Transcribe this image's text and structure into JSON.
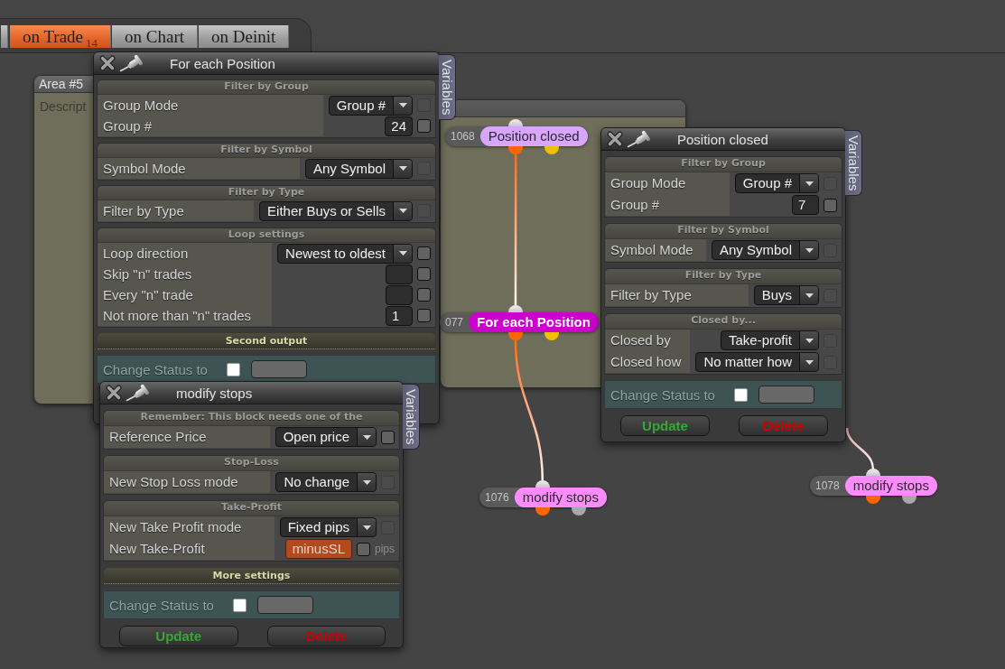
{
  "tabs": [
    {
      "selected": false
    },
    {
      "label": "on Trade",
      "badge": "14",
      "selected": true
    },
    {
      "label": "on Chart",
      "selected": false
    },
    {
      "label": "on Deinit",
      "selected": false
    }
  ],
  "areas": [
    {
      "kind": "titled",
      "title": "Area #5",
      "description": "Descript"
    },
    {
      "kind": "untitled"
    }
  ],
  "windows": [
    {
      "title": "For each Position",
      "side_tab": "Variables",
      "sections": [
        {
          "kind": "group",
          "title": "Filter by Group",
          "rows": [
            {
              "label": "Group Mode",
              "kind": "select",
              "value": "Group #",
              "checkbox_enabled": false
            },
            {
              "label": "Group #",
              "kind": "input",
              "value": "24",
              "checkbox_enabled": true
            }
          ]
        },
        {
          "kind": "group",
          "title": "Filter by Symbol",
          "rows": [
            {
              "label": "Symbol Mode",
              "kind": "select",
              "value": "Any Symbol",
              "checkbox_enabled": false
            }
          ]
        },
        {
          "kind": "group",
          "title": "Filter by Type",
          "rows": [
            {
              "label": "Filter by Type",
              "kind": "select",
              "value": "Either Buys or Sells",
              "checkbox_enabled": false
            }
          ]
        },
        {
          "kind": "group",
          "title": "Loop settings",
          "rows": [
            {
              "label": "Loop direction",
              "kind": "select",
              "value": "Newest to oldest",
              "checkbox_enabled": true
            },
            {
              "label": "Skip \"n\" trades",
              "kind": "input",
              "checkbox_enabled": true
            },
            {
              "label": "Every \"n\" trade",
              "kind": "input",
              "checkbox_enabled": true
            },
            {
              "label": "Not more than \"n\" trades",
              "kind": "input",
              "value": "1",
              "checkbox_enabled": true
            }
          ]
        },
        {
          "kind": "output",
          "title": "Second output"
        }
      ],
      "status": {
        "label": "Change Status to",
        "checked": false
      }
    },
    {
      "title": "modify stops",
      "side_tab": "Variables",
      "sections": [
        {
          "kind": "group",
          "title": "Remember: This block needs one of the",
          "rows": [
            {
              "label": "Reference Price",
              "kind": "select",
              "value": "Open price",
              "checkbox_enabled": true
            }
          ]
        },
        {
          "kind": "group",
          "title": "Stop-Loss",
          "rows": [
            {
              "label": "New Stop Loss mode",
              "kind": "select",
              "value": "No change",
              "checkbox_enabled": false
            }
          ]
        },
        {
          "kind": "group",
          "title": "Take-Profit",
          "rows": [
            {
              "label": "New Take Profit mode",
              "kind": "select",
              "value": "Fixed pips",
              "checkbox_enabled": false
            },
            {
              "label": "New Take-Profit",
              "kind": "variable",
              "value": "minusSL",
              "checkbox_enabled": true,
              "unit": "pips"
            }
          ]
        },
        {
          "kind": "output",
          "title": "More settings"
        }
      ],
      "status": {
        "label": "Change Status to",
        "checked": false
      },
      "buttons": [
        {
          "label": "Update",
          "kind": "update"
        },
        {
          "label": "Delete",
          "kind": "delete"
        }
      ]
    },
    {
      "title": "Position closed",
      "side_tab": "Variables",
      "sections": [
        {
          "kind": "group",
          "title": "Filter by Group",
          "rows": [
            {
              "label": "Group Mode",
              "kind": "select",
              "value": "Group #",
              "checkbox_enabled": false
            },
            {
              "label": "Group #",
              "kind": "input",
              "value": "7",
              "checkbox_enabled": true
            }
          ]
        },
        {
          "kind": "group",
          "title": "Filter by Symbol",
          "rows": [
            {
              "label": "Symbol Mode",
              "kind": "select",
              "value": "Any Symbol",
              "checkbox_enabled": false
            }
          ]
        },
        {
          "kind": "group",
          "title": "Filter by Type",
          "rows": [
            {
              "label": "Filter by Type",
              "kind": "select",
              "value": "Buys",
              "checkbox_enabled": false
            }
          ]
        },
        {
          "kind": "group",
          "title": "Closed by...",
          "rows": [
            {
              "label": "Closed by",
              "kind": "select",
              "value": "Take-profit",
              "checkbox_enabled": false
            },
            {
              "label": "Closed how",
              "kind": "select",
              "value": "No matter how",
              "checkbox_enabled": false
            }
          ]
        }
      ],
      "status": {
        "label": "Change Status to",
        "checked": false
      },
      "buttons": [
        {
          "label": "Update",
          "kind": "update"
        },
        {
          "label": "Delete",
          "kind": "delete"
        }
      ]
    }
  ],
  "nodes": [
    {
      "id": "1068",
      "label": "Position closed",
      "color": "#d9a6ff",
      "selected": false,
      "outputs": [
        {
          "color": "#ff6600"
        },
        {
          "color": "#f0c000"
        }
      ]
    },
    {
      "id": "077",
      "label": "For each Position",
      "color": "#cc00cc",
      "selected": true,
      "input_wire": {
        "kind": "node"
      },
      "outputs": [
        {
          "color": "#ff6600"
        },
        {
          "color": "#f0c000"
        }
      ]
    },
    {
      "id": "1076",
      "label": "modify stops",
      "color": "#ff8cff",
      "selected": false,
      "input_wire": {
        "kind": "node"
      },
      "outputs": [
        {
          "color": "#ff6600"
        },
        {
          "color": "#a8a8a8"
        }
      ]
    },
    {
      "id": "1078",
      "label": "modify stops",
      "color": "#ff8cff",
      "selected": false,
      "input_wire": {
        "kind": "window"
      },
      "outputs": [
        {
          "color": "#ff6600"
        },
        {
          "color": "#a8a8a8"
        }
      ]
    }
  ]
}
